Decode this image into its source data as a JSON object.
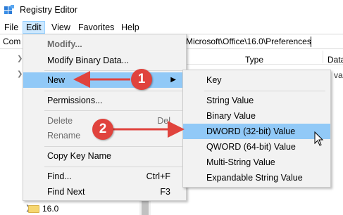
{
  "window": {
    "title": "Registry Editor",
    "icon": "registry-editor-icon"
  },
  "menubar": {
    "items": [
      {
        "label": "File"
      },
      {
        "label": "Edit"
      },
      {
        "label": "View"
      },
      {
        "label": "Favorites"
      },
      {
        "label": "Help"
      }
    ]
  },
  "address": {
    "prefix": "Com",
    "path": "Microsoft\\Office\\16.0\\Preferences"
  },
  "list": {
    "columns": {
      "type": "Type",
      "data": "Data"
    },
    "value_fragment": "val"
  },
  "tree": {
    "visible_node": "16.0"
  },
  "edit_menu": {
    "items": [
      {
        "label": "Modify...",
        "shortcut": ""
      },
      {
        "label": "Modify Binary Data...",
        "shortcut": ""
      },
      {
        "label": "New",
        "shortcut": ""
      },
      {
        "label": "Permissions...",
        "shortcut": ""
      },
      {
        "label": "Delete",
        "shortcut": "Del"
      },
      {
        "label": "Rename",
        "shortcut": ""
      },
      {
        "label": "Copy Key Name",
        "shortcut": ""
      },
      {
        "label": "Find...",
        "shortcut": "Ctrl+F"
      },
      {
        "label": "Find Next",
        "shortcut": "F3"
      }
    ]
  },
  "new_submenu": {
    "items": [
      {
        "label": "Key"
      },
      {
        "label": "String Value"
      },
      {
        "label": "Binary Value"
      },
      {
        "label": "DWORD (32-bit) Value"
      },
      {
        "label": "QWORD (64-bit) Value"
      },
      {
        "label": "Multi-String Value"
      },
      {
        "label": "Expandable String Value"
      }
    ]
  },
  "annotations": {
    "step1": "1",
    "step2": "2",
    "color": "#e0433d"
  },
  "colors": {
    "highlight": "#91c9f7",
    "menu_bg": "#f2f2f2",
    "active_menu": "#cce8ff"
  }
}
